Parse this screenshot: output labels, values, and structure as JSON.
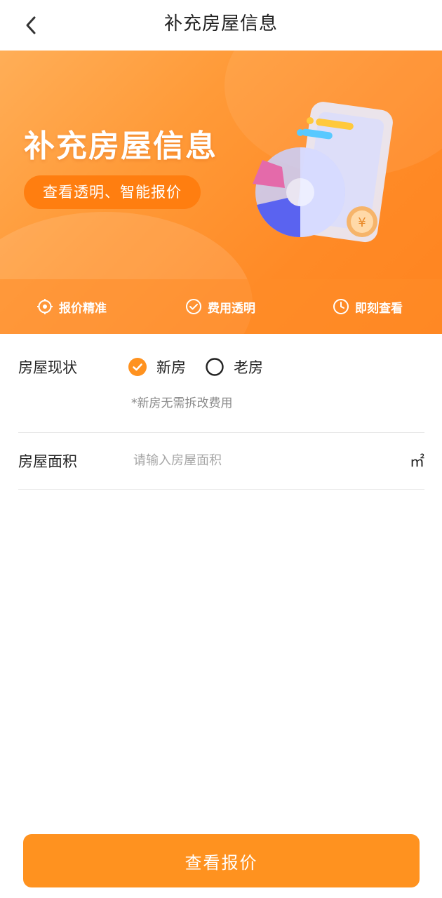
{
  "nav": {
    "title": "补充房屋信息"
  },
  "banner": {
    "title": "补充房屋信息",
    "subtitle": "查看透明、智能报价",
    "features": [
      {
        "label": "报价精准",
        "icon": "target-icon"
      },
      {
        "label": "费用透明",
        "icon": "check-circle-icon"
      },
      {
        "label": "即刻查看",
        "icon": "clock-icon"
      }
    ]
  },
  "form": {
    "status": {
      "label": "房屋现状",
      "options": [
        {
          "label": "新房",
          "selected": true
        },
        {
          "label": "老房",
          "selected": false
        }
      ],
      "hint": "*新房无需拆改费用"
    },
    "area": {
      "label": "房屋面积",
      "placeholder": "请输入房屋面积",
      "value": "",
      "unit": "㎡"
    }
  },
  "submit": {
    "label": "查看报价"
  },
  "colors": {
    "accent": "#ff921f",
    "banner": "#ff8a26",
    "text": "#222222",
    "hint": "#8a8a8a"
  }
}
